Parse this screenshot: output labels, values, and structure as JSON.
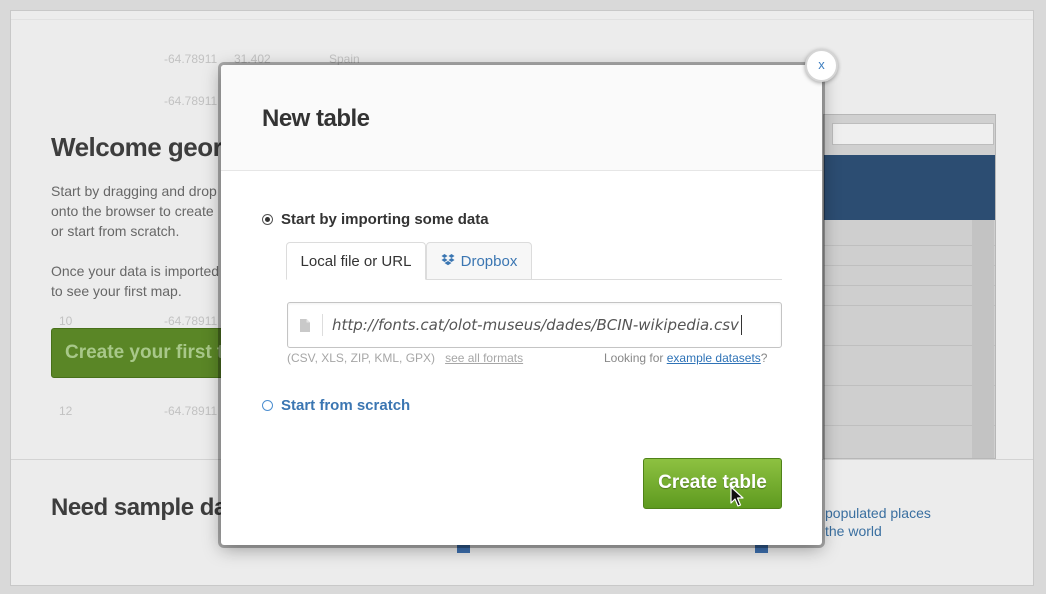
{
  "background": {
    "welcome_heading": "Welcome geor",
    "intro_lines": [
      "Start by dragging and drop",
      "onto the browser to create",
      "or start from scratch."
    ],
    "import_lines": [
      "Once your data is imported",
      "to see your first map."
    ],
    "create_first_button": "Create your first t",
    "sample_heading": "Need sample da",
    "sample_links": [
      "populated places",
      "the world"
    ],
    "table_rows": [
      {
        "index": "",
        "lon": "-64.78911",
        "lat": "31.402",
        "name": "Spain"
      },
      {
        "index": "",
        "lon": "-64.78911",
        "lat": "",
        "name": ""
      },
      {
        "index": "10",
        "lon": "-64.78911",
        "lat": "",
        "name": ""
      },
      {
        "index": "12",
        "lon": "-64.78911",
        "lat": "",
        "name": ""
      }
    ]
  },
  "modal": {
    "title": "New table",
    "close_label": "x",
    "option_import": "Start by importing some data",
    "option_scratch": "Start from scratch",
    "tabs": [
      {
        "label": "Local file or URL",
        "icon": "none"
      },
      {
        "label": "Dropbox",
        "icon": "dropbox-icon"
      }
    ],
    "url_value": "http://fonts.cat/olot-museus/dades/BCIN-wikipedia.csv",
    "formats_hint": "(CSV, XLS, ZIP, KML, GPX)",
    "see_all_formats": "see all formats",
    "looking_for": "Looking for",
    "example_datasets": "example datasets",
    "question_mark": "?",
    "create_button": "Create table"
  },
  "colors": {
    "accent_blue": "#3b76b2",
    "button_green": "#78ae32"
  }
}
